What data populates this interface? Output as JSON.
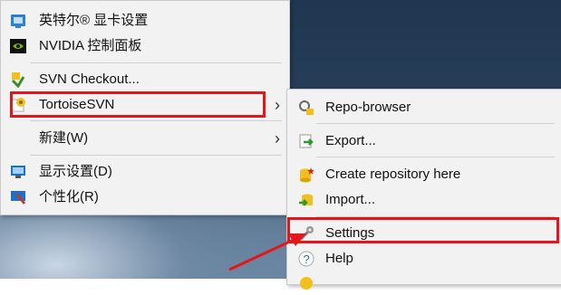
{
  "context_menu": {
    "items": [
      {
        "label": "英特尔® 显卡设置",
        "icon": "intel-graphics-icon"
      },
      {
        "label": "NVIDIA 控制面板",
        "icon": "nvidia-icon"
      },
      {
        "label": "SVN Checkout...",
        "icon": "svn-checkout-icon"
      },
      {
        "label": "TortoiseSVN",
        "icon": "tortoisesvn-icon"
      },
      {
        "label": "新建(W)",
        "icon": ""
      },
      {
        "label": "显示设置(D)",
        "icon": "display-settings-icon"
      },
      {
        "label": "个性化(R)",
        "icon": "personalize-icon"
      }
    ]
  },
  "submenu": {
    "items": [
      {
        "label": "Repo-browser",
        "icon": "repo-browser-icon"
      },
      {
        "label": "Export...",
        "icon": "export-icon"
      },
      {
        "label": "Create repository here",
        "icon": "create-repo-icon"
      },
      {
        "label": "Import...",
        "icon": "import-icon"
      },
      {
        "label": "Settings",
        "icon": "settings-icon"
      },
      {
        "label": "Help",
        "icon": "help-icon"
      }
    ]
  },
  "colors": {
    "highlight_red": "#e5161b",
    "menu_bg": "#f2f2f2"
  }
}
